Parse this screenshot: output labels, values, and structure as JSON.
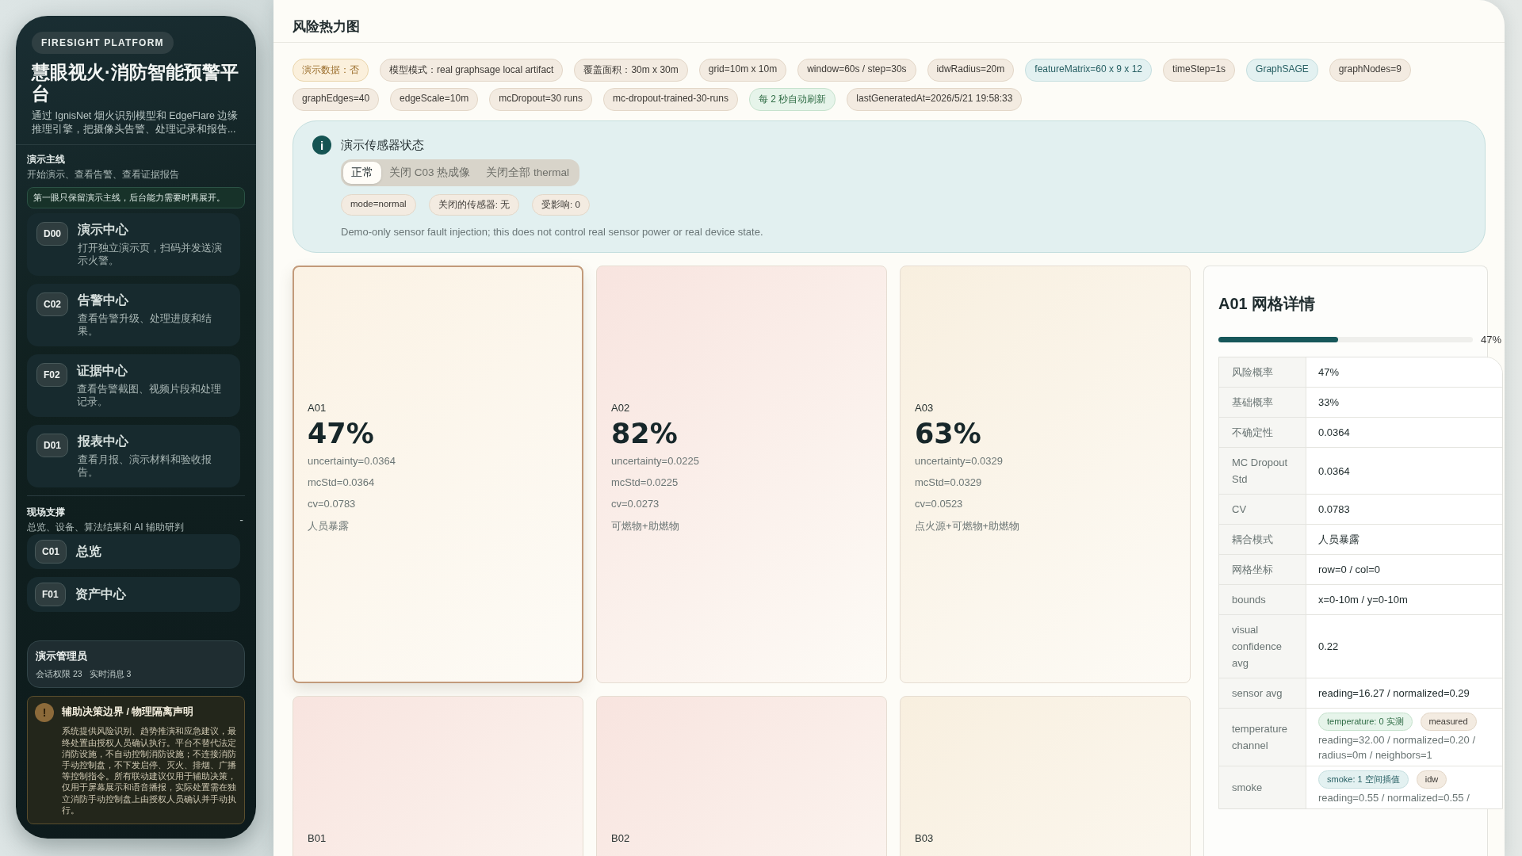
{
  "sidebar": {
    "badge": "FIRESIGHT PLATFORM",
    "title": "慧眼视火·消防智能预警平台",
    "description": "通过 IgnisNet 烟火识别模型和 EdgeFlare 边缘推理引擎，把摄像头告警、处理记录和报告...",
    "sections": [
      {
        "title": "演示主线",
        "subtitle": "开始演示、查看告警、查看证据报告",
        "hint": "第一眼只保留演示主线，后台能力需要时再展开。",
        "items": [
          {
            "code": "D00",
            "label": "演示中心",
            "description": "打开独立演示页，扫码并发送演示火警。"
          },
          {
            "code": "C02",
            "label": "告警中心",
            "description": "查看告警升级、处理进度和结果。"
          },
          {
            "code": "F02",
            "label": "证据中心",
            "description": "查看告警截图、视频片段和处理记录。"
          },
          {
            "code": "D01",
            "label": "报表中心",
            "description": "查看月报、演示材料和验收报告。"
          }
        ]
      },
      {
        "title": "现场支撑",
        "subtitle": "总览、设备、算法结果和 AI 辅助研判",
        "toggle": "-",
        "items": [
          {
            "code": "C01",
            "label": "总览"
          },
          {
            "code": "F01",
            "label": "资产中心"
          }
        ]
      }
    ],
    "user": {
      "name": "演示管理员",
      "stats": [
        "会话权限 23",
        "实时消息 3"
      ]
    },
    "notice": {
      "icon": "!",
      "title": "辅助决策边界 / 物理隔离声明",
      "text": "系统提供风险识别、趋势推演和应急建议，最终处置由授权人员确认执行。平台不替代法定消防设施，不自动控制消防设施；不连接消防手动控制盘，不下发启停、灭火、排烟、广播等控制指令。所有联动建议仅用于辅助决策，仅用于屏幕展示和语音播报，实际处置需在独立消防手动控制盘上由授权人员确认并手动执行。"
    }
  },
  "main": {
    "title": "风险热力图",
    "tags": [
      {
        "text": "演示数据：否",
        "kind": "warn"
      },
      {
        "text": "模型模式：real graphsage local artifact",
        "kind": "plain"
      },
      {
        "text": "覆盖面积：30m x 30m",
        "kind": "plain"
      },
      {
        "text": "grid=10m x 10m",
        "kind": "plain"
      },
      {
        "text": "window=60s / step=30s",
        "kind": "plain"
      },
      {
        "text": "idwRadius=20m",
        "kind": "plain"
      },
      {
        "text": "featureMatrix=60 x 9 x 12",
        "kind": "info"
      },
      {
        "text": "timeStep=1s",
        "kind": "plain"
      },
      {
        "text": "GraphSAGE",
        "kind": "info"
      },
      {
        "text": "graphNodes=9",
        "kind": "plain"
      },
      {
        "text": "graphEdges=40",
        "kind": "plain"
      },
      {
        "text": "edgeScale=10m",
        "kind": "plain"
      },
      {
        "text": "mcDropout=30 runs",
        "kind": "plain"
      },
      {
        "text": "mc-dropout-trained-30-runs",
        "kind": "plain"
      },
      {
        "text": "每 2 秒自动刷新",
        "kind": "ok"
      },
      {
        "text": "lastGeneratedAt=2026/5/21 19:58:33",
        "kind": "plain"
      }
    ],
    "sensor_panel": {
      "icon": "i",
      "title": "演示传感器状态",
      "modes": [
        {
          "label": "正常",
          "selected": true
        },
        {
          "label": "关闭 C03 热成像",
          "selected": false
        },
        {
          "label": "关闭全部 thermal",
          "selected": false
        }
      ],
      "tags": [
        "mode=normal",
        "关闭的传感器: 无",
        "受影响: 0"
      ],
      "note": "Demo-only sensor fault injection; this does not control real sensor power or real device state."
    },
    "cells": [
      {
        "label": "A01",
        "value": "47%",
        "metrics": [
          "uncertainty=0.0364",
          "mcStd=0.0364",
          "cv=0.0783"
        ],
        "mode": "人员暴露",
        "color": "#fbf2e4",
        "selected": true
      },
      {
        "label": "A02",
        "value": "82%",
        "metrics": [
          "uncertainty=0.0225",
          "mcStd=0.0225",
          "cv=0.0273"
        ],
        "mode": "可燃物+助燃物",
        "color": "#f8e4df",
        "selected": false
      },
      {
        "label": "A03",
        "value": "63%",
        "metrics": [
          "uncertainty=0.0329",
          "mcStd=0.0329",
          "cv=0.0523"
        ],
        "mode": "点火源+可燃物+助燃物",
        "color": "#f8efdf",
        "selected": false
      },
      {
        "label": "B01",
        "color": "#f8e4df",
        "selected": false
      },
      {
        "label": "B02",
        "color": "#f8e4df",
        "selected": false
      },
      {
        "label": "B03",
        "color": "#f8efdf",
        "selected": false
      }
    ],
    "detail": {
      "title": "A01 网格详情",
      "level": 0.47,
      "reading": "47%",
      "rows": [
        {
          "kind": "text",
          "label": "风险概率",
          "value": "47%"
        },
        {
          "kind": "text",
          "label": "基础概率",
          "value": "33%"
        },
        {
          "kind": "text",
          "label": "不确定性",
          "value": "0.0364"
        },
        {
          "kind": "text",
          "label": "MC Dropout Std",
          "value": "0.0364"
        },
        {
          "kind": "text",
          "label": "CV",
          "value": "0.0783"
        },
        {
          "kind": "text",
          "label": "耦合模式",
          "value": "人员暴露"
        },
        {
          "kind": "text",
          "label": "网格坐标",
          "value": "row=0 / col=0"
        },
        {
          "kind": "text",
          "label": "bounds",
          "value": "x=0-10m / y=0-10m"
        },
        {
          "kind": "text",
          "label": "visual confidence avg",
          "value": "0.22"
        },
        {
          "kind": "text",
          "label": "sensor avg",
          "value": "reading=16.27 / normalized=0.29"
        },
        {
          "kind": "channel",
          "label": "temperature channel",
          "tags": [
            {
              "text": "temperature: 0 实测",
              "kind": "ok"
            },
            {
              "text": "measured",
              "kind": "plain"
            }
          ],
          "value": "reading=32.00 / normalized=0.20 / radius=0m / neighbors=1"
        },
        {
          "kind": "channel",
          "label": "smoke",
          "tags": [
            {
              "text": "smoke: 1 空间插值",
              "kind": "info"
            },
            {
              "text": "idw",
              "kind": "plain"
            }
          ],
          "value": "reading=0.55 / normalized=0.55 /"
        }
      ]
    }
  }
}
